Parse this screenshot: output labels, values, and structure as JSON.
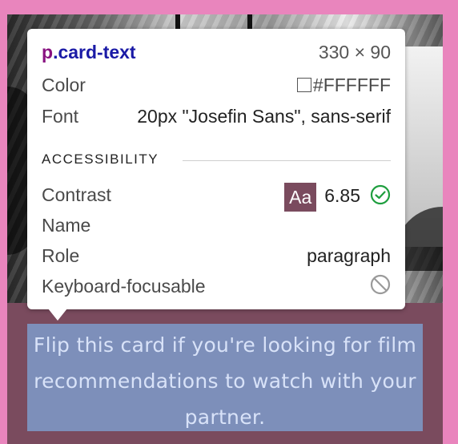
{
  "tooltip": {
    "selector_tag": "p",
    "selector_class": ".card-text",
    "dimensions": "330 × 90",
    "color_label": "Color",
    "color_value": "#FFFFFF",
    "font_label": "Font",
    "font_value": "20px \"Josefin Sans\", sans-serif",
    "accessibility_title": "ACCESSIBILITY",
    "contrast_label": "Contrast",
    "contrast_badge": "Aa",
    "contrast_value": "6.85",
    "name_label": "Name",
    "role_label": "Role",
    "role_value": "paragraph",
    "focusable_label": "Keyboard-focusable"
  },
  "card": {
    "text": "Flip this card if you're looking for film recommendations to watch with your partner."
  },
  "colors": {
    "page_background": "#e985bd",
    "card_background": "#7a4b5e",
    "highlight": "#7d8fba",
    "contrast_pass": "#1e9e3e"
  },
  "icons": {
    "contrast_status": "check-circle-icon",
    "focusable_status": "not-allowed-icon"
  }
}
